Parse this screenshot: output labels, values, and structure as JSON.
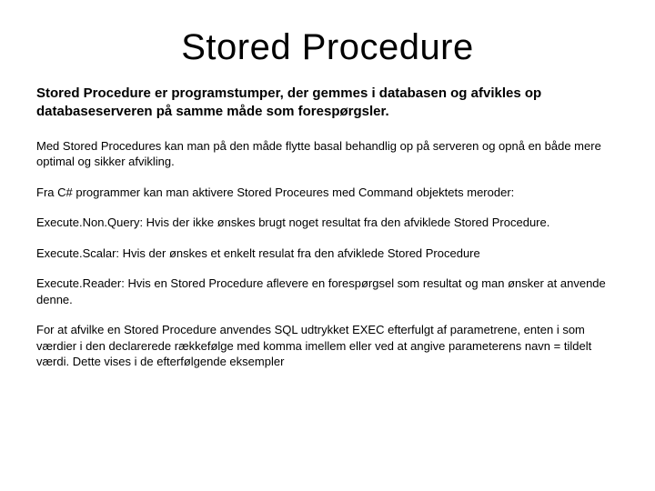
{
  "title": "Stored Procedure",
  "intro": "Stored Procedure er programstumper, der gemmes i databasen og afvikles op databaseserveren på samme måde som forespørgsler.",
  "paragraphs": [
    "Med Stored Procedures kan man på den måde flytte basal behandlig op på serveren og opnå en både mere optimal og sikker afvikling.",
    "Fra C# programmer kan man aktivere Stored Proceures med Command objektets meroder:",
    "Execute.Non.Query: Hvis der ikke ønskes brugt noget resultat fra den afviklede Stored Procedure.",
    "Execute.Scalar: Hvis der ønskes et enkelt resulat fra den afviklede Stored Procedure",
    "Execute.Reader: Hvis en Stored Procedure aflevere en forespørgsel som resultat og man ønsker at anvende denne.",
    "For at afvilke en Stored Procedure anvendes SQL udtrykket EXEC efterfulgt af parametrene, enten i som værdier i den declarerede rækkefølge med komma imellem eller ved at angive parameterens navn = tildelt værdi. Dette vises i de efterfølgende eksempler"
  ]
}
